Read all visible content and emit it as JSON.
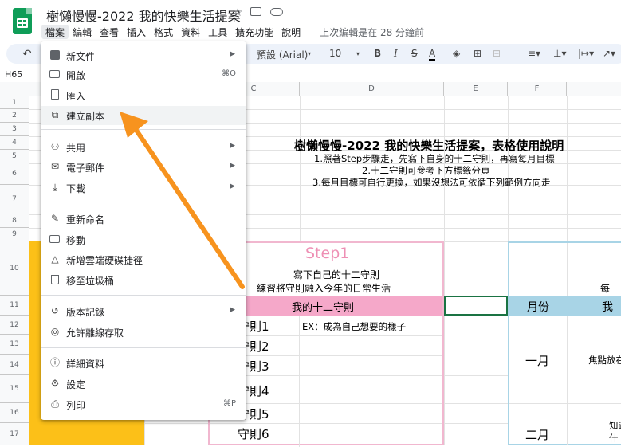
{
  "window": {
    "title": "樹懶慢慢-2022 我的快樂生活提案",
    "icons": [
      "star-icon",
      "move-to-folder-icon",
      "cloud-status-icon"
    ]
  },
  "menubar": {
    "items": [
      "檔案",
      "編輯",
      "查看",
      "插入",
      "格式",
      "資料",
      "工具",
      "擴充功能",
      "說明"
    ],
    "last_edit": "上次編輯是在 28 分鐘前"
  },
  "toolbar": {
    "font": "預設 (Arial)",
    "font_size": "10",
    "bold": "B",
    "italic": "I",
    "strike": "S",
    "text_color": "A"
  },
  "namebox": "H65",
  "columns": [
    "C",
    "D",
    "E",
    "F"
  ],
  "rows": [
    "1",
    "2",
    "3",
    "4",
    "5",
    "6",
    "7",
    "8",
    "9",
    "10",
    "11",
    "12",
    "13",
    "14",
    "15",
    "16",
    "17"
  ],
  "file_menu": {
    "items": [
      {
        "label": "新文件",
        "icon": "new-doc-icon",
        "submenu": true
      },
      {
        "label": "開啟",
        "icon": "open-folder-icon",
        "shortcut": "⌘O"
      },
      {
        "label": "匯入",
        "icon": "import-icon"
      },
      {
        "label": "建立副本",
        "icon": "copy-icon"
      },
      {
        "label": "共用",
        "icon": "share-icon",
        "submenu": true
      },
      {
        "label": "電子郵件",
        "icon": "email-icon",
        "submenu": true
      },
      {
        "label": "下載",
        "icon": "download-icon",
        "submenu": true
      },
      {
        "label": "重新命名",
        "icon": "rename-icon"
      },
      {
        "label": "移動",
        "icon": "move-icon"
      },
      {
        "label": "新增雲端硬碟捷徑",
        "icon": "drive-shortcut-icon"
      },
      {
        "label": "移至垃圾桶",
        "icon": "trash-icon"
      },
      {
        "label": "版本記錄",
        "icon": "history-icon",
        "submenu": true
      },
      {
        "label": "允許離線存取",
        "icon": "offline-icon"
      },
      {
        "label": "詳細資料",
        "icon": "info-icon"
      },
      {
        "label": "設定",
        "icon": "settings-icon"
      },
      {
        "label": "列印",
        "icon": "print-icon",
        "shortcut": "⌘P"
      }
    ]
  },
  "sheet": {
    "heading": "樹懶慢慢-2022 我的快樂生活提案，表格使用說明",
    "instructions": [
      "1.照著Step步驟走，先寫下自身的十二守則，再寫每月目標",
      "2.十二守則可參考下方標籤分頁",
      "3.每月目標可自行更換，如果沒想法可依循下列範例方向走"
    ],
    "step_title": "Step1",
    "step_desc_1": "寫下自己的十二守則",
    "step_desc_2": "練習將守則融入今年的日常生活",
    "rules_header": "我的十二守則",
    "rules": [
      "守則1",
      "守則2",
      "守則3",
      "守則4",
      "守則5",
      "守則6"
    ],
    "rule_example": "EX：成為自己想要的樣子",
    "month_header": "月份",
    "months": [
      "一月",
      "二月"
    ],
    "partial_header": "我",
    "partial_top": "每",
    "partial_jan": "焦點放在",
    "partial_feb_1": "知道",
    "partial_feb_2": "什"
  },
  "colors": {
    "accent_pink": "#f5a8c9",
    "pink_border": "#f1b7cf",
    "step_pink": "#ee8fb4",
    "blue_header": "#a8d4e6",
    "yellow": "#fcc018",
    "arrow": "#f7931e",
    "selection": "#1a7343"
  }
}
